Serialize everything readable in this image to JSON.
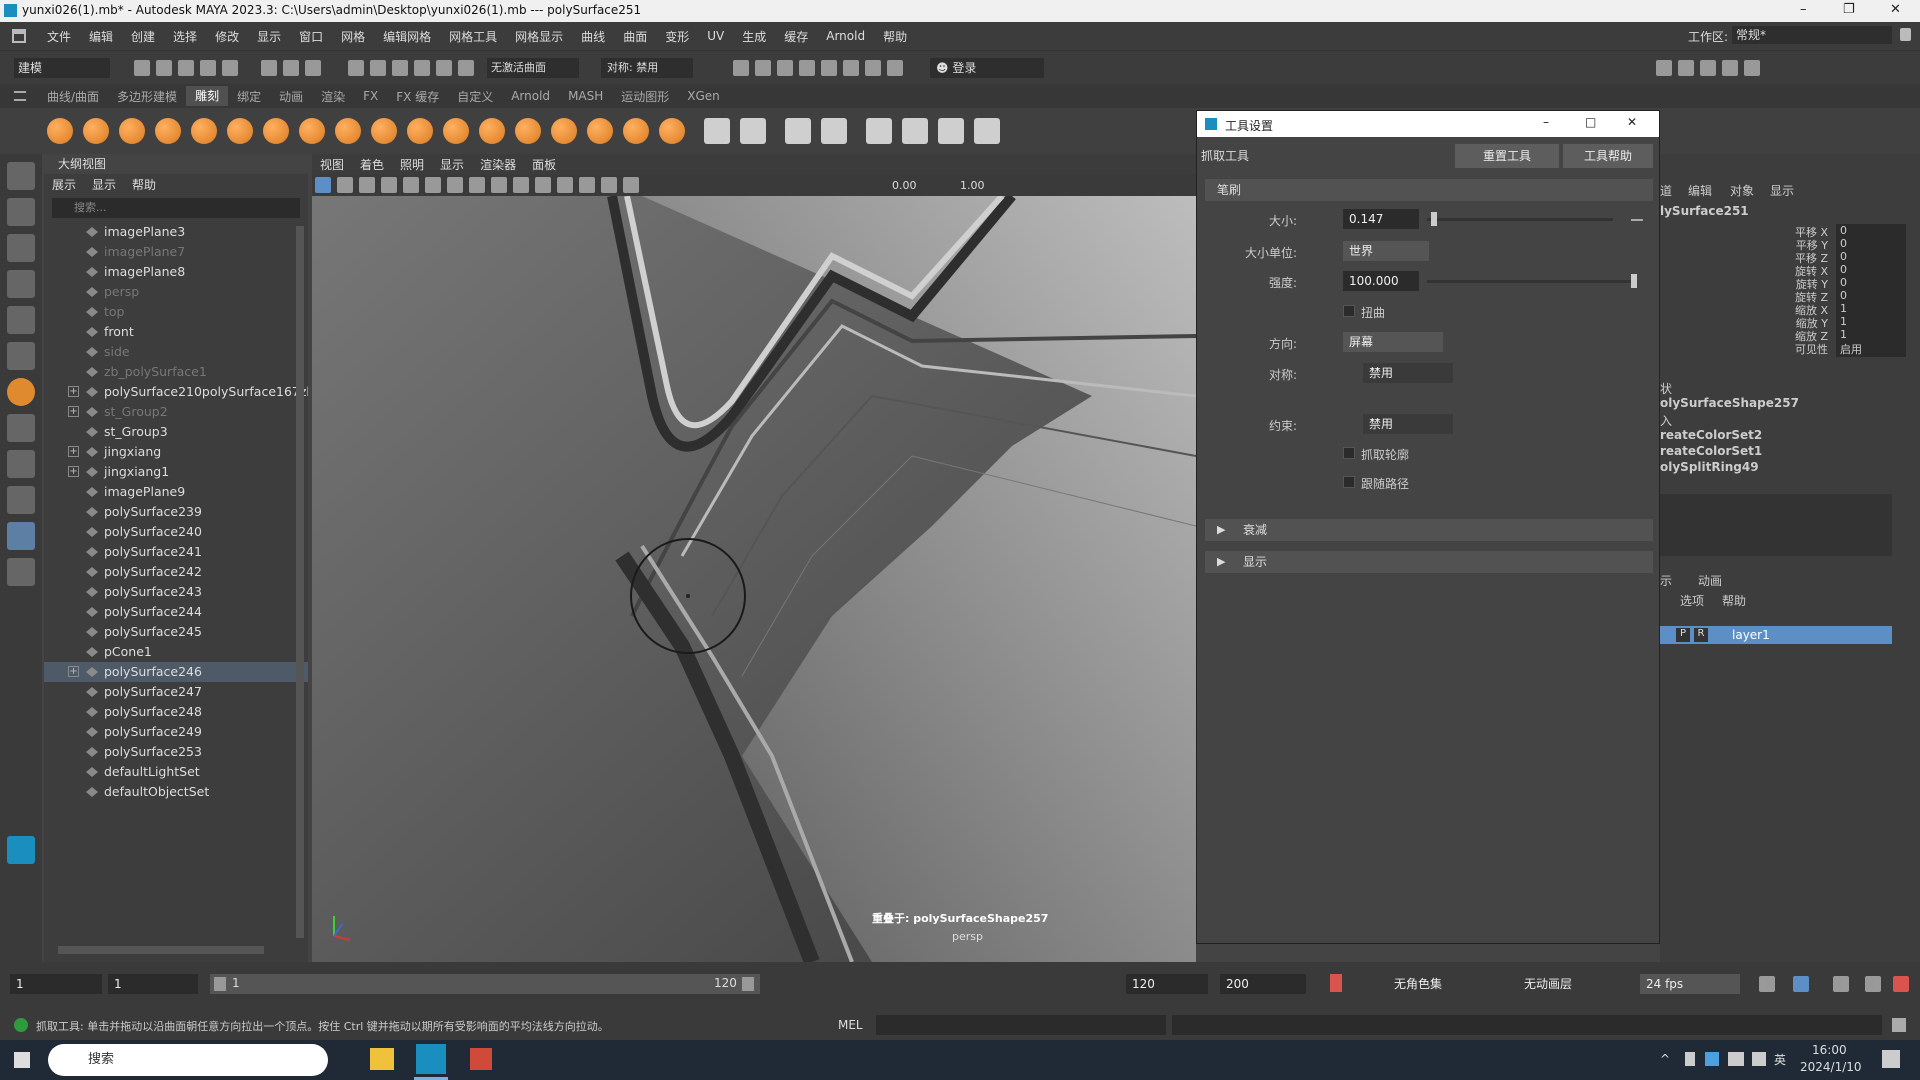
{
  "window": {
    "title": "yunxi026(1).mb* - Autodesk MAYA 2023.3: C:\\Users\\admin\\Desktop\\yunxi026(1).mb   ---   polySurface251",
    "minimize": "–",
    "restore": "❐",
    "close": "✕"
  },
  "menubar": {
    "items": [
      "文件",
      "编辑",
      "创建",
      "选择",
      "修改",
      "显示",
      "窗口",
      "网格",
      "编辑网格",
      "网格工具",
      "网格显示",
      "曲线",
      "曲面",
      "变形",
      "UV",
      "生成",
      "缓存",
      "Arnold",
      "帮助"
    ],
    "workspace_label": "工作区:",
    "workspace_value": "常规*"
  },
  "statusline": {
    "mode": "建模",
    "live_surface": "无激活曲面",
    "symmetry": "对称: 禁用",
    "login": "登录"
  },
  "shelf": {
    "tabs": [
      "曲线/曲面",
      "多边形建模",
      "雕刻",
      "绑定",
      "动画",
      "渲染",
      "FX",
      "FX 缓存",
      "自定义",
      "Arnold",
      "MASH",
      "运动图形",
      "XGen"
    ],
    "active_tab": "雕刻"
  },
  "outliner": {
    "title": "大纲视图",
    "menu": [
      "展示",
      "显示",
      "帮助"
    ],
    "search_placeholder": "搜索...",
    "items": [
      {
        "label": "imagePlane3",
        "dim": false,
        "expand": false
      },
      {
        "label": "imagePlane7",
        "dim": true,
        "expand": false
      },
      {
        "label": "imagePlane8",
        "dim": false,
        "expand": false
      },
      {
        "label": "persp",
        "dim": true,
        "expand": false
      },
      {
        "label": "top",
        "dim": true,
        "expand": false
      },
      {
        "label": "front",
        "dim": false,
        "expand": false
      },
      {
        "label": "side",
        "dim": true,
        "expand": false
      },
      {
        "label": "zb_polySurface1",
        "dim": true,
        "expand": false
      },
      {
        "label": "polySurface210polySurface167zb",
        "dim": false,
        "expand": true
      },
      {
        "label": "st_Group2",
        "dim": true,
        "expand": true
      },
      {
        "label": "st_Group3",
        "dim": false,
        "expand": false
      },
      {
        "label": "jingxiang",
        "dim": false,
        "expand": true
      },
      {
        "label": "jingxiang1",
        "dim": false,
        "expand": true
      },
      {
        "label": "imagePlane9",
        "dim": false,
        "expand": false
      },
      {
        "label": "polySurface239",
        "dim": false,
        "expand": false
      },
      {
        "label": "polySurface240",
        "dim": false,
        "expand": false
      },
      {
        "label": "polySurface241",
        "dim": false,
        "expand": false
      },
      {
        "label": "polySurface242",
        "dim": false,
        "expand": false
      },
      {
        "label": "polySurface243",
        "dim": false,
        "expand": false
      },
      {
        "label": "polySurface244",
        "dim": false,
        "expand": false
      },
      {
        "label": "polySurface245",
        "dim": false,
        "expand": false
      },
      {
        "label": "pCone1",
        "dim": false,
        "expand": false
      },
      {
        "label": "polySurface246",
        "dim": false,
        "expand": true,
        "sel": true
      },
      {
        "label": "polySurface247",
        "dim": false,
        "expand": false
      },
      {
        "label": "polySurface248",
        "dim": false,
        "expand": false
      },
      {
        "label": "polySurface249",
        "dim": false,
        "expand": false
      },
      {
        "label": "polySurface253",
        "dim": false,
        "expand": false
      },
      {
        "label": "defaultLightSet",
        "dim": false,
        "expand": false
      },
      {
        "label": "defaultObjectSet",
        "dim": false,
        "expand": false
      }
    ]
  },
  "viewport": {
    "menu": [
      "视图",
      "着色",
      "照明",
      "显示",
      "渲染器",
      "面板"
    ],
    "value_a": "0.00",
    "value_b": "1.00",
    "hud_object": "重叠于: polySurfaceShape257",
    "camera": "persp"
  },
  "toolsettings": {
    "title": "工具设置",
    "tool_name": "抓取工具",
    "reset_button": "重置工具",
    "help_button": "工具帮助",
    "brush_section": "笔刷",
    "size_label": "大小:",
    "size_value": "0.147",
    "size_fraction": 0.03,
    "size_unit_label": "大小单位:",
    "size_unit_value": "世界",
    "strength_label": "强度:",
    "strength_value": "100.000",
    "strength_fraction": 1.0,
    "twist_label": "扭曲",
    "direction_label": "方向:",
    "direction_value": "屏幕",
    "symmetry_label": "对称:",
    "symmetry_value": "禁用",
    "constraint_label": "约束:",
    "constraint_value": "禁用",
    "grab_silhouette": "抓取轮廓",
    "follow_path": "跟随路径",
    "falloff_section": "衰减",
    "display_section": "显示"
  },
  "channelbox": {
    "menu": [
      "道",
      "编辑",
      "对象",
      "显示"
    ],
    "object": "lySurface251",
    "attrs": [
      {
        "name": "平移 X",
        "value": "0"
      },
      {
        "name": "平移 Y",
        "value": "0"
      },
      {
        "name": "平移 Z",
        "value": "0"
      },
      {
        "name": "旋转 X",
        "value": "0"
      },
      {
        "name": "旋转 Y",
        "value": "0"
      },
      {
        "name": "旋转 Z",
        "value": "0"
      },
      {
        "name": "缩放 X",
        "value": "1"
      },
      {
        "name": "缩放 Y",
        "value": "1"
      },
      {
        "name": "缩放 Z",
        "value": "1"
      },
      {
        "name": "可见性",
        "value": "启用"
      }
    ],
    "shapes_label": "状",
    "shape": "olySurfaceShape257",
    "inputs_label": "入",
    "inputs": [
      "reateColorSet2",
      "reateColorSet1",
      "olySplitRing49"
    ],
    "layer_tabs": [
      "示",
      "动画"
    ],
    "layer_menu": [
      "选项",
      "帮助"
    ],
    "layer_flags": [
      "P",
      "R"
    ],
    "layer": "layer1"
  },
  "timeslider": {
    "frame_a": "1",
    "frame_b": "1",
    "range_start": "1",
    "range_end": "120",
    "end_a": "120",
    "end_b": "200",
    "charset": "无角色集",
    "anim_layer": "无动画层",
    "fps": "24 fps"
  },
  "helpline": {
    "text": "抓取工具: 单击并拖动以沿曲面朝任意方向拉出一个顶点。按住 Ctrl 键并拖动以期所有受影响面的平均法线方向拉动。",
    "mel": "MEL"
  },
  "taskbar": {
    "search": "搜索",
    "ime": "英",
    "time": "16:00",
    "date": "2024/1/10"
  }
}
